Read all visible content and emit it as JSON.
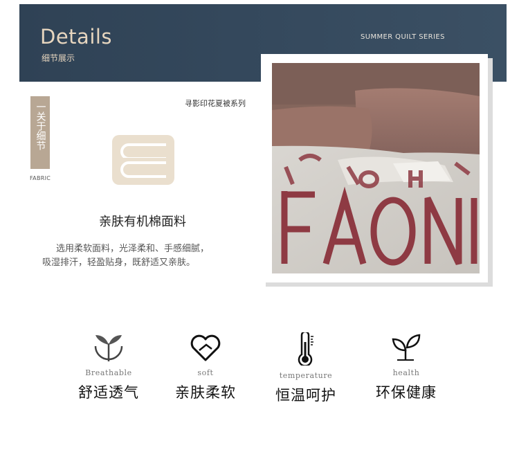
{
  "header": {
    "title": "Details",
    "subtitle": "细节展示",
    "series_en": "SUMMER QUILT SERIES"
  },
  "side_tag": {
    "text": "一关于细节",
    "caption": "FABRIC"
  },
  "series_cn": "寻影印花夏被系列",
  "feature": {
    "title": "亲肤有机棉面料",
    "desc_line1": "选用柔软面料，光泽柔和、手感细腻，",
    "desc_line2": "吸湿排汗，轻盈贴身，既舒适又亲肤。"
  },
  "photo": {
    "print_letters": "FAONI"
  },
  "features": [
    {
      "icon": "leaf-bowl-icon",
      "en": "Breathable",
      "cn": "舒适透气"
    },
    {
      "icon": "heart-icon",
      "en": "soft",
      "cn": "亲肤柔软"
    },
    {
      "icon": "thermometer-icon",
      "en": "temperature",
      "cn": "恒温呵护"
    },
    {
      "icon": "sprout-icon",
      "en": "health",
      "cn": "环保健康"
    }
  ],
  "colors": {
    "header_bg": "#33475b",
    "accent_gold": "#e7d6bf",
    "tag_bg": "#b8a794",
    "print_red": "#8e3a43"
  }
}
